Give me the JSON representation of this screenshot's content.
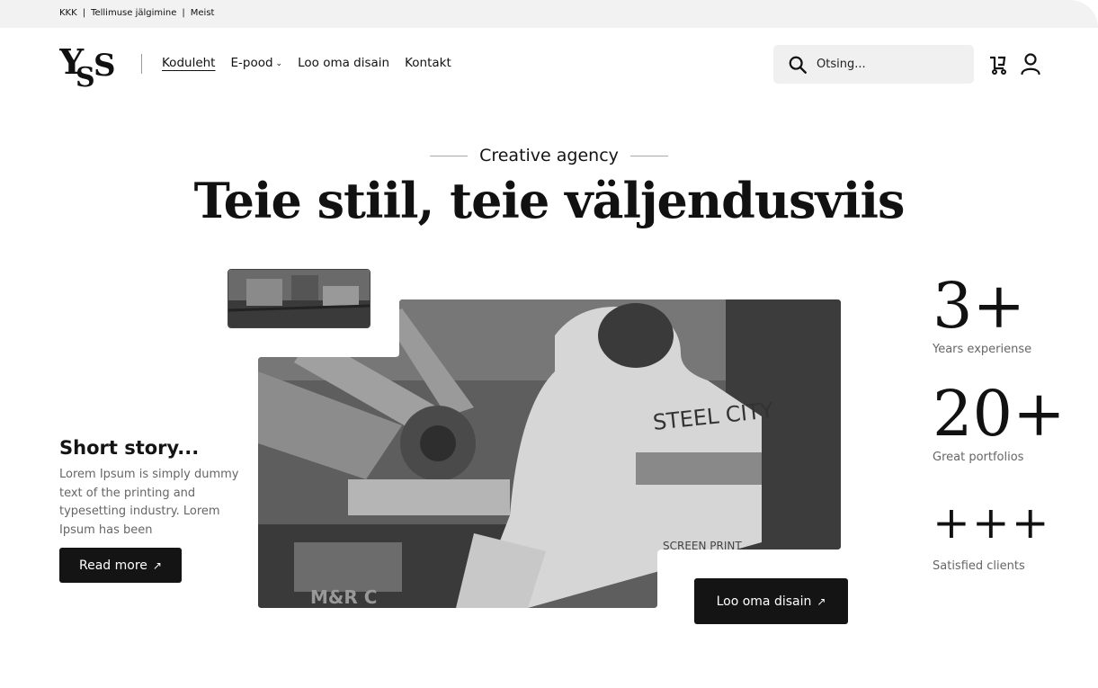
{
  "topbar": {
    "links": [
      "KKK",
      "Tellimuse jälgimine",
      "Meist"
    ],
    "separator": "|"
  },
  "logo": {
    "text": "YSS"
  },
  "nav": {
    "items": [
      {
        "label": "Koduleht",
        "active": true
      },
      {
        "label": "E-pood",
        "has_dropdown": true
      },
      {
        "label": "Loo oma disain"
      },
      {
        "label": "Kontakt"
      }
    ],
    "dropdown_icon": "⌄"
  },
  "search": {
    "placeholder": "Otsing..."
  },
  "hero": {
    "eyebrow": "Creative agency",
    "headline": "Teie stiil, teie väljendusviis",
    "photo_text": {
      "shirt": "STEEL CITY",
      "shirt_bottom": "SCREEN PRINT",
      "machine": "M&R C"
    }
  },
  "story": {
    "title": "Short story...",
    "text": "Lorem Ipsum is simply dummy text of the printing and typesetting industry. Lorem Ipsum has been",
    "button_label": "Read more"
  },
  "cta": {
    "label": "Loo oma disain"
  },
  "arrow_glyph": "↗",
  "stats": [
    {
      "value": "3+",
      "label": "Years experiense"
    },
    {
      "value": "20+",
      "label": "Great portfolios"
    },
    {
      "value": "+++",
      "label": "Satisfied clients"
    }
  ],
  "colors": {
    "primary": "#141414",
    "topbar_bg": "#f2f2f2",
    "search_bg": "#f0f0f0",
    "muted_text": "#666666"
  }
}
